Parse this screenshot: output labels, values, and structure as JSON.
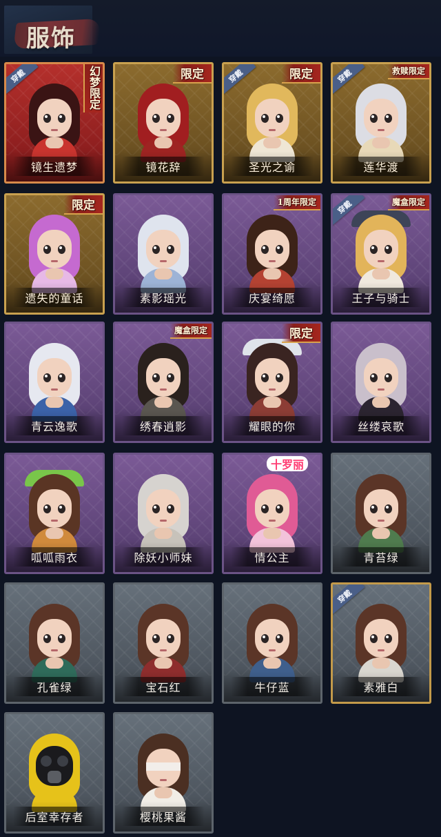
{
  "header": {
    "title": "服饰"
  },
  "cards": [
    {
      "label": "镜生遗梦",
      "rarity": "red",
      "worn": true,
      "tag": "幻梦限定",
      "tag_style": "vertical"
    },
    {
      "label": "镜花辞",
      "rarity": "gold",
      "worn": false,
      "tag": "限定"
    },
    {
      "label": "圣光之谕",
      "rarity": "gold",
      "worn": true,
      "tag": "限定"
    },
    {
      "label": "莲华渡",
      "rarity": "gold",
      "worn": true,
      "tag": "救赎限定"
    },
    {
      "label": "遗失的童话",
      "rarity": "gold",
      "worn": false,
      "tag": "限定"
    },
    {
      "label": "素影瑶光",
      "rarity": "purple",
      "worn": false,
      "tag": ""
    },
    {
      "label": "庆宴绮愿",
      "rarity": "purple",
      "worn": false,
      "tag": "1周年限定"
    },
    {
      "label": "王子与骑士",
      "rarity": "purple",
      "worn": true,
      "tag": "魔盒限定"
    },
    {
      "label": "青云逸歌",
      "rarity": "purple",
      "worn": false,
      "tag": ""
    },
    {
      "label": "绣春逍影",
      "rarity": "purple",
      "worn": false,
      "tag": "魔盒限定"
    },
    {
      "label": "耀眼的你",
      "rarity": "purple",
      "worn": false,
      "tag": "限定"
    },
    {
      "label": "丝缕哀歌",
      "rarity": "purple",
      "worn": false,
      "tag": ""
    },
    {
      "label": "呱呱雨衣",
      "rarity": "purple",
      "worn": false,
      "tag": ""
    },
    {
      "label": "除妖小师妹",
      "rarity": "purple",
      "worn": false,
      "tag": ""
    },
    {
      "label": "情公主",
      "rarity": "purple",
      "worn": false,
      "tag": "十罗丽",
      "tag_style": "logo"
    },
    {
      "label": "青苔绿",
      "rarity": "gray",
      "worn": false,
      "tag": ""
    },
    {
      "label": "孔雀绿",
      "rarity": "gray",
      "worn": false,
      "tag": ""
    },
    {
      "label": "宝石红",
      "rarity": "gray",
      "worn": false,
      "tag": ""
    },
    {
      "label": "牛仔蓝",
      "rarity": "gray",
      "worn": false,
      "tag": ""
    },
    {
      "label": "素雅白",
      "rarity": "gray",
      "worn": true,
      "tag": ""
    },
    {
      "label": "后室幸存者",
      "rarity": "gray",
      "worn": false,
      "tag": ""
    },
    {
      "label": "樱桃果酱",
      "rarity": "gray",
      "worn": false,
      "tag": ""
    }
  ],
  "badges": {
    "worn_label": "穿戴"
  },
  "colors": {
    "background": "#0e1422",
    "red_frame": "#b5302c",
    "gold_frame": "#c9a14f",
    "purple_frame": "#7b5a96",
    "gray_frame": "#5d646b",
    "worn_badge": "#4a5f88"
  }
}
